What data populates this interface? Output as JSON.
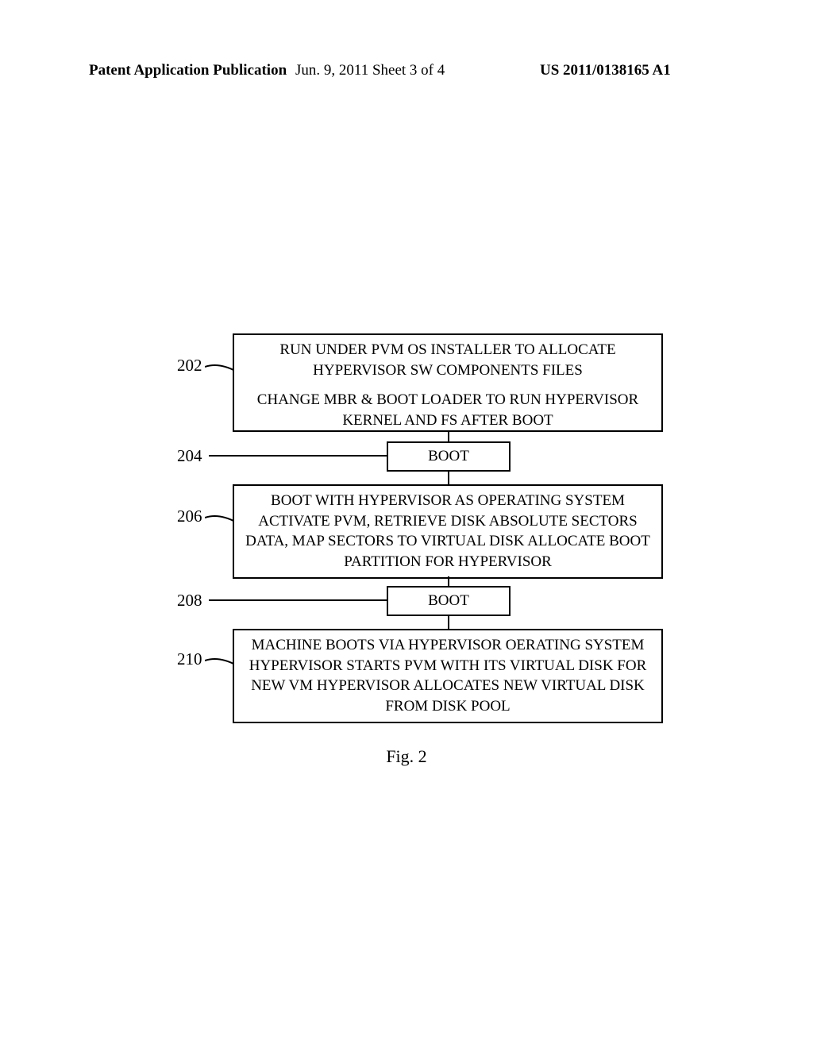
{
  "header": {
    "left": "Patent Application Publication",
    "center": "Jun. 9, 2011  Sheet 3 of 4",
    "right": "US 2011/0138165 A1"
  },
  "refs": {
    "r202": "202",
    "r204": "204",
    "r206": "206",
    "r208": "208",
    "r210": "210"
  },
  "steps": {
    "s202a": "RUN UNDER PVM OS INSTALLER TO ALLOCATE HYPERVISOR SW COMPONENTS FILES",
    "s202b": "CHANGE MBR & BOOT LOADER TO RUN HYPERVISOR KERNEL AND FS AFTER BOOT",
    "s204": "BOOT",
    "s206": "BOOT WITH HYPERVISOR AS OPERATING SYSTEM ACTIVATE PVM, RETRIEVE DISK ABSOLUTE SECTORS DATA, MAP SECTORS TO VIRTUAL DISK ALLOCATE BOOT PARTITION FOR HYPERVISOR",
    "s208": "BOOT",
    "s210": "MACHINE BOOTS VIA HYPERVISOR OERATING SYSTEM HYPERVISOR STARTS PVM WITH ITS VIRTUAL DISK FOR NEW VM HYPERVISOR ALLOCATES NEW VIRTUAL DISK FROM DISK POOL"
  },
  "caption": "Fig. 2",
  "chart_data": {
    "type": "table",
    "title": "Fig. 2 — Hypervisor installation & boot flow",
    "rows": [
      {
        "ref": "202",
        "text": "RUN UNDER PVM OS INSTALLER TO ALLOCATE HYPERVISOR SW COMPONENTS FILES; CHANGE MBR & BOOT LOADER TO RUN HYPERVISOR KERNEL AND FS AFTER BOOT"
      },
      {
        "ref": "204",
        "text": "BOOT"
      },
      {
        "ref": "206",
        "text": "BOOT WITH HYPERVISOR AS OPERATING SYSTEM; ACTIVATE PVM, RETRIEVE DISK ABSOLUTE SECTORS DATA, MAP SECTORS TO VIRTUAL DISK; ALLOCATE BOOT PARTITION FOR HYPERVISOR"
      },
      {
        "ref": "208",
        "text": "BOOT"
      },
      {
        "ref": "210",
        "text": "MACHINE BOOTS VIA HYPERVISOR OERATING SYSTEM; HYPERVISOR STARTS PVM WITH ITS VIRTUAL DISK; FOR NEW VM HYPERVISOR ALLOCATES NEW VIRTUAL DISK FROM DISK POOL"
      }
    ]
  }
}
